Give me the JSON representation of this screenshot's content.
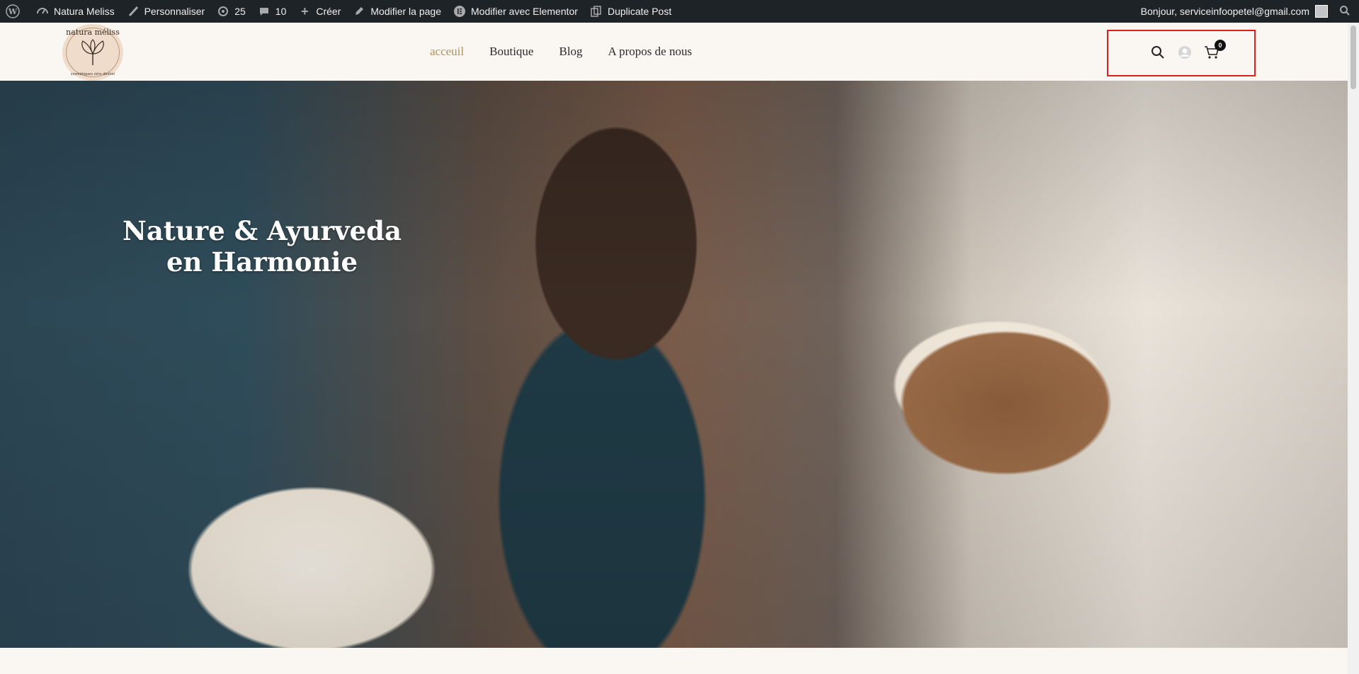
{
  "adminbar": {
    "wp_logo_icon": "wordpress-icon",
    "site_name": "Natura Meliss",
    "customize": "Personnaliser",
    "updates": "25",
    "comments": "10",
    "new": "Créer",
    "edit_page": "Modifier la page",
    "elementor": "Modifier avec Elementor",
    "duplicate": "Duplicate Post",
    "greeting": "Bonjour, serviceinfoopetel@gmail.com"
  },
  "logo": {
    "top_text": "natura méliss",
    "bottom_text": "cosmétiques zéro déchet"
  },
  "nav": {
    "items": [
      "acceuil",
      "Boutique",
      "Blog",
      "A propos de nous"
    ],
    "active_index": 0,
    "active_color": "#b09060"
  },
  "header_icons": {
    "search_icon": "search-icon",
    "account_icon": "user-icon",
    "cart_icon": "cart-icon",
    "cart_count": "0",
    "highlight_color": "#e01e1e"
  },
  "hero": {
    "title_line1": "Nature & Ayurveda",
    "title_line2": "en Harmonie"
  }
}
